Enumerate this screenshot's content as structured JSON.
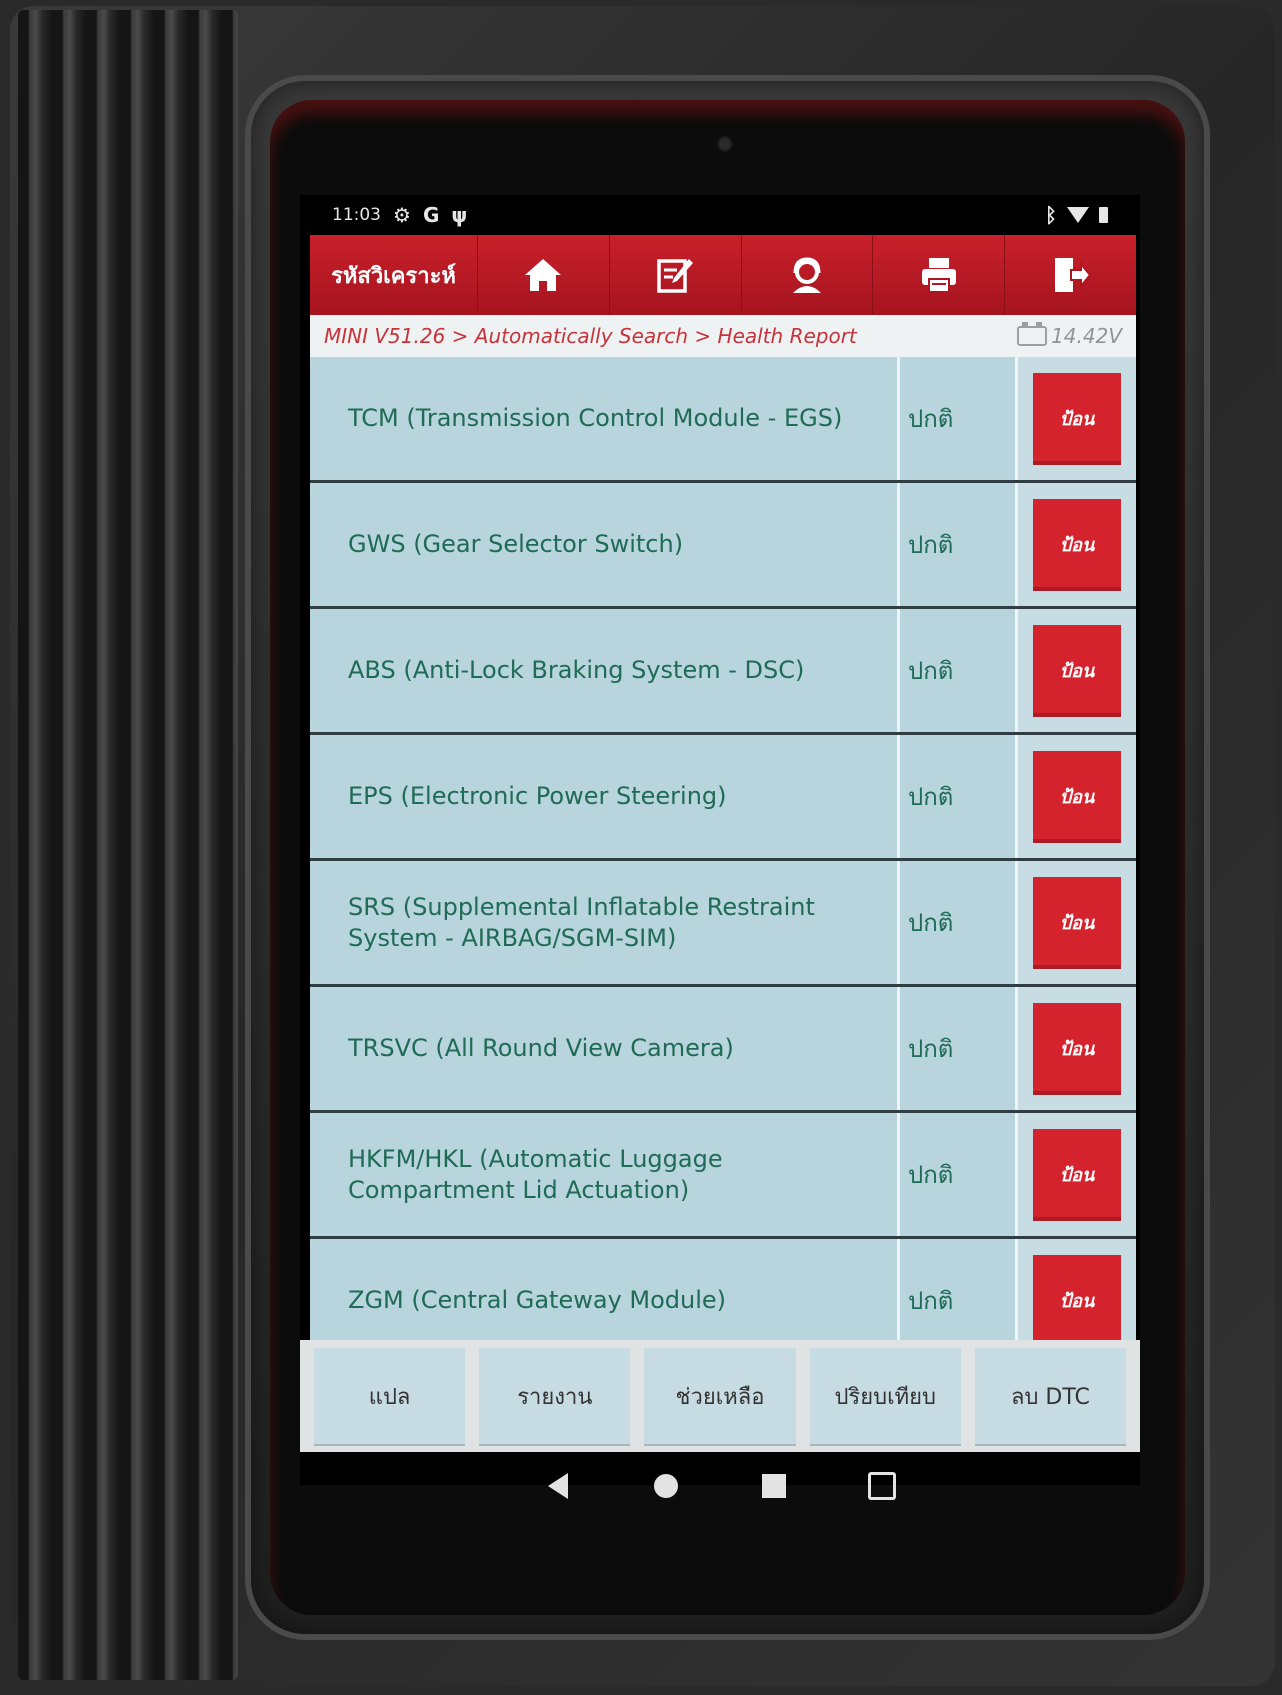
{
  "status_bar": {
    "time": "11:03",
    "left_icons": [
      "settings-icon",
      "google-icon",
      "usb-debug-icon"
    ],
    "right_icons": [
      "bluetooth-icon",
      "wifi-icon",
      "battery-icon"
    ]
  },
  "toolbar": {
    "title": "รหัสวิเคราะห์",
    "buttons": [
      {
        "icon": "home-icon"
      },
      {
        "icon": "edit-icon"
      },
      {
        "icon": "support-icon"
      },
      {
        "icon": "print-icon"
      },
      {
        "icon": "exit-icon"
      }
    ],
    "background": "#c01b25"
  },
  "breadcrumb": {
    "path": "MINI V51.26 > Automatically Search > Health Report",
    "voltage": "14.42V"
  },
  "modules": [
    {
      "name": "TCM (Transmission Control Module - EGS)",
      "status": "ปกติ",
      "action": "ป้อน"
    },
    {
      "name": "GWS (Gear Selector Switch)",
      "status": "ปกติ",
      "action": "ป้อน"
    },
    {
      "name": "ABS (Anti-Lock Braking System - DSC)",
      "status": "ปกติ",
      "action": "ป้อน"
    },
    {
      "name": "EPS (Electronic Power Steering)",
      "status": "ปกติ",
      "action": "ป้อน"
    },
    {
      "name": "SRS (Supplemental Inflatable Restraint System - AIRBAG/SGM-SIM)",
      "status": "ปกติ",
      "action": "ป้อน"
    },
    {
      "name": "TRSVC (All Round View Camera)",
      "status": "ปกติ",
      "action": "ป้อน"
    },
    {
      "name": "HKFM/HKL (Automatic Luggage Compartment Lid Actuation)",
      "status": "ปกติ",
      "action": "ป้อน"
    },
    {
      "name": "ZGM (Central Gateway Module)",
      "status": "ปกติ",
      "action": "ป้อน"
    }
  ],
  "action_bar": {
    "buttons": [
      "แปล",
      "รายงาน",
      "ช่วยเหลือ",
      "ปริยบเทียบ",
      "ลบ DTC"
    ]
  },
  "nav_bar": {
    "keys": [
      "back-icon",
      "home-icon",
      "recent-apps-icon",
      "screenshot-icon"
    ]
  },
  "colors": {
    "accent_red": "#d4232d",
    "row_bg": "#b8d4dd",
    "text_green": "#1f6b55"
  }
}
